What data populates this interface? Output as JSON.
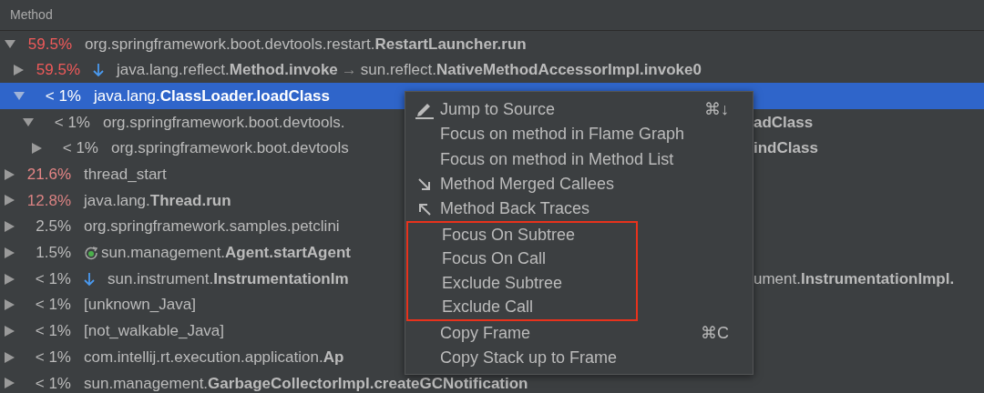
{
  "header": {
    "title": "Method"
  },
  "tree": [
    {
      "percent": "59.5%",
      "color": "#f05a5a",
      "text": "org.springframework.boot.devtools.restart.**RestartLauncher.run**",
      "expanded": true,
      "selected": false,
      "children": [
        {
          "percent": "59.5%",
          "color": "#f05a5a",
          "kind": "callee",
          "text": "java.lang.reflect.**Method.invoke**",
          "arrow": "→",
          "text_after": "sun.reflect.**NativeMethodAccessorImpl.invoke0**",
          "expanded": false,
          "selected": false
        },
        {
          "percent": "< 1%",
          "text": "java.lang.**ClassLoader.loadClass**",
          "expanded": true,
          "selected": true,
          "children": [
            {
              "percent": "< 1%",
              "color": "#bbbbbb",
              "text": "org.springframework.boot.devtools.",
              "tail": "**adClass**",
              "expanded": true,
              "selected": false,
              "children": [
                {
                  "percent": "< 1%",
                  "color": "#bbbbbb",
                  "text": "org.springframework.boot.devtools",
                  "tail": "**indClass**",
                  "expanded": false,
                  "selected": false
                }
              ]
            }
          ]
        }
      ]
    },
    {
      "percent": "21.6%",
      "color": "#e48585",
      "text": "thread_start",
      "expanded": false,
      "selected": false
    },
    {
      "percent": "12.8%",
      "color": "#d98282",
      "text": "java.lang.**Thread.run**",
      "expanded": false,
      "selected": false
    },
    {
      "percent": "2.5%",
      "color": "#bbbbbb",
      "text": "org.springframework.samples.petclini",
      "expanded": false,
      "selected": false
    },
    {
      "percent": "1.5%",
      "color": "#bbbbbb",
      "kind": "recursion",
      "text": "sun.management.**Agent.startAgent**",
      "expanded": false,
      "selected": false
    },
    {
      "percent": "< 1%",
      "color": "#bbbbbb",
      "kind": "callee",
      "text": "sun.instrument.**InstrumentationIm**",
      "tail": "ument.**InstrumentationImpl.**",
      "expanded": false,
      "selected": false
    },
    {
      "percent": "< 1%",
      "color": "#bbbbbb",
      "text": "[unknown_Java]",
      "expanded": false,
      "selected": false
    },
    {
      "percent": "< 1%",
      "color": "#bbbbbb",
      "text": "[not_walkable_Java]",
      "expanded": false,
      "selected": false
    },
    {
      "percent": "< 1%",
      "color": "#bbbbbb",
      "text": "com.intellij.rt.execution.application.**Ap**",
      "expanded": false,
      "selected": false
    },
    {
      "percent": "< 1%",
      "color": "#bbbbbb",
      "text": "sun.management.**GarbageCollectorImpl.createGCNotification**",
      "expanded": false,
      "selected": false
    }
  ],
  "context_menu": [
    {
      "label": "Jump to Source",
      "kind": "edit",
      "shortcut": "⌘↓",
      "highlighted": false
    },
    {
      "label": "Focus on method in Flame Graph",
      "highlighted": false
    },
    {
      "label": "Focus on method in Method List",
      "highlighted": false
    },
    {
      "label": "Method Merged Callees",
      "kind": "callees",
      "highlighted": false
    },
    {
      "label": "Method Back Traces",
      "kind": "back-traces",
      "highlighted": false
    },
    {
      "label": "Focus On Subtree",
      "highlighted": true
    },
    {
      "label": "Focus On Call",
      "highlighted": true
    },
    {
      "label": "Exclude Subtree",
      "highlighted": true
    },
    {
      "label": "Exclude Call",
      "highlighted": true
    },
    {
      "label": "Copy Frame",
      "shortcut": "⌘C",
      "highlighted": false
    },
    {
      "label": "Copy Stack up to Frame",
      "highlighted": false
    }
  ]
}
